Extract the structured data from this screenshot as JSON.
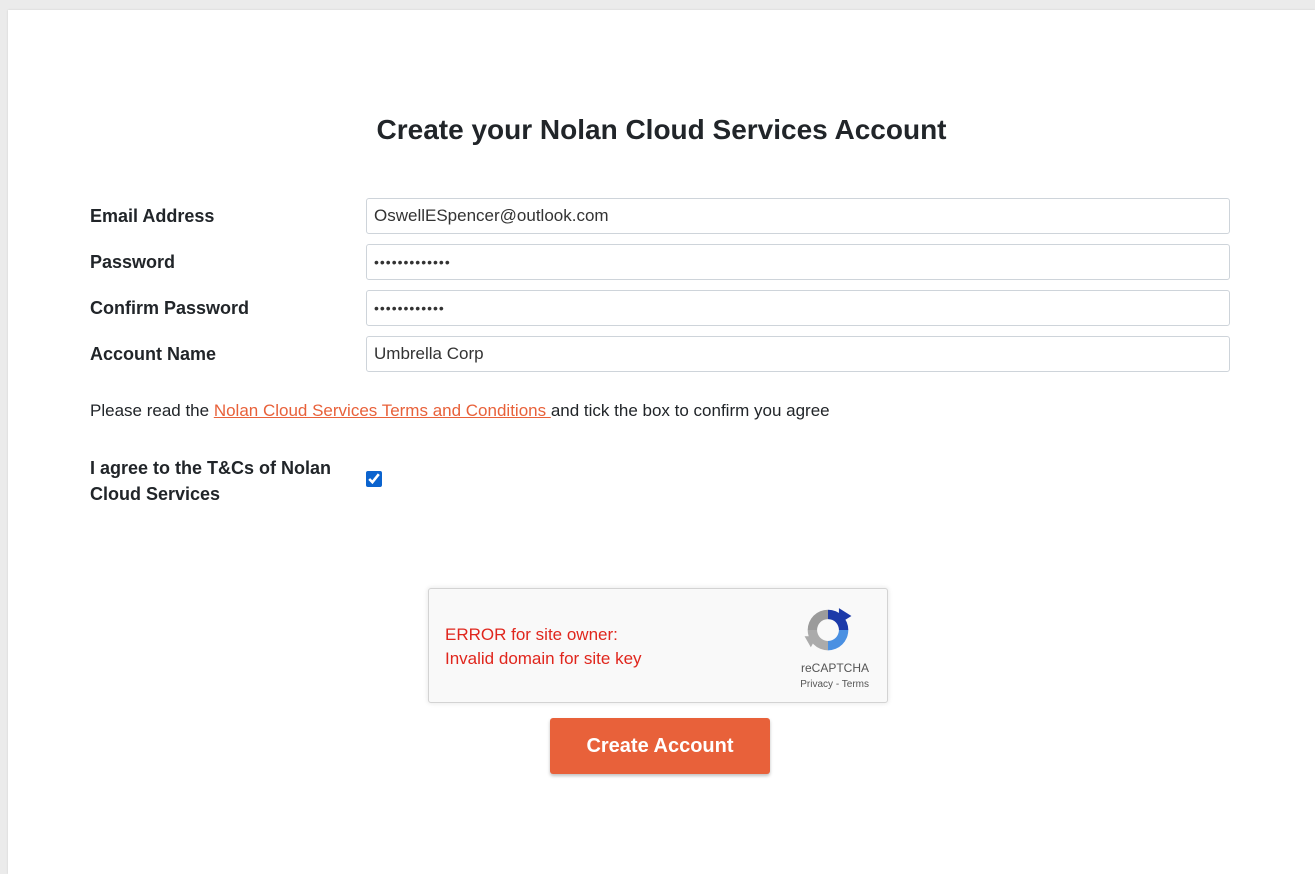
{
  "page": {
    "title": "Create your Nolan Cloud Services Account"
  },
  "form": {
    "email": {
      "label": "Email Address",
      "value": "OswellESpencer@outlook.com"
    },
    "password": {
      "label": "Password",
      "value": "•••••••••••••"
    },
    "confirm_password": {
      "label": "Confirm Password",
      "value": "••••••••••••"
    },
    "account_name": {
      "label": "Account Name",
      "value": "Umbrella Corp"
    }
  },
  "terms": {
    "prefix": "Please read the ",
    "link_text": "Nolan Cloud Services Terms and Conditions ",
    "suffix": "and tick the box to confirm you agree",
    "link_color": "#e8613a"
  },
  "agree": {
    "label": "I agree to the T&Cs of Nolan Cloud Services",
    "checked": true
  },
  "captcha": {
    "error_line1": "ERROR for site owner:",
    "error_line2": "Invalid domain for site key",
    "brand": "reCAPTCHA",
    "privacy_label": "Privacy",
    "separator": " - ",
    "terms_label": "Terms",
    "logo_icon": "recaptcha-logo-icon",
    "error_color": "#e0261d"
  },
  "submit": {
    "label": "Create Account",
    "color": "#e8613a"
  }
}
